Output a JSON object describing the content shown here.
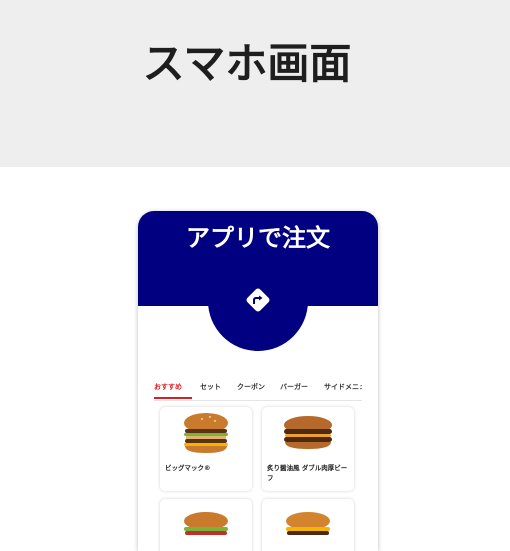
{
  "page": {
    "title": "スマホ画面"
  },
  "app": {
    "header_title": "アプリで注文",
    "header_icon": "turn-right-arrow-icon",
    "colors": {
      "brand_navy": "#000080",
      "active_tab": "#d91f26",
      "top_band": "#eeeeee"
    },
    "tabs": [
      {
        "label": "おすすめ",
        "active": true
      },
      {
        "label": "セット",
        "active": false
      },
      {
        "label": "クーポン",
        "active": false
      },
      {
        "label": "バーガー",
        "active": false
      },
      {
        "label": "サイドメニュ",
        "active": false
      }
    ],
    "products": [
      {
        "name": "ビッグマック®",
        "image": "big-mac-burger-image"
      },
      {
        "name": "炙り醤油風 ダブル肉厚ビーフ",
        "image": "double-beef-burger-image"
      },
      {
        "name": "",
        "image": "burger-image"
      },
      {
        "name": "",
        "image": "cheese-burger-image"
      }
    ]
  }
}
